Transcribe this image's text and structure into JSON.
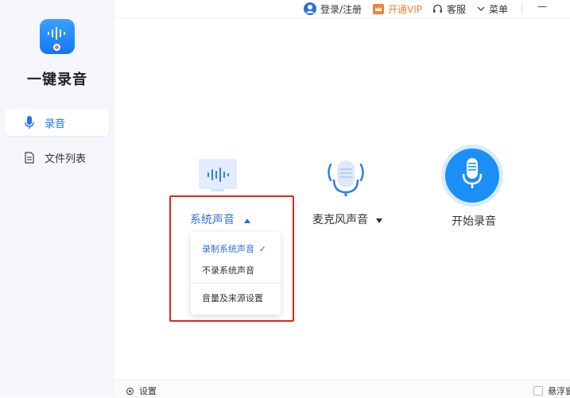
{
  "app": {
    "title": "一键录音"
  },
  "sidebar": {
    "items": [
      {
        "label": "录音",
        "icon": "microphone-icon",
        "active": true
      },
      {
        "label": "文件列表",
        "icon": "document-icon",
        "active": false
      }
    ]
  },
  "topbar": {
    "login_label": "登录/注册",
    "vip_label": "开通VIP",
    "service_label": "客服",
    "menu_label": "菜单",
    "minimize_glyph": "—"
  },
  "main": {
    "system_audio_label": "系统声音",
    "mic_audio_label": "麦克风声音",
    "start_label": "开始录音"
  },
  "dropdown": {
    "items": [
      "录制系统声音",
      "不录系统声音",
      "音量及来源设置"
    ],
    "selected": "录制系统声音",
    "check_glyph": "✓"
  },
  "bottombar": {
    "settings_label": "设置",
    "float_label": "悬浮窗"
  },
  "colors": {
    "accent": "#1f74f0",
    "vip": "#ff7a33",
    "highlight": "#e3241b"
  }
}
